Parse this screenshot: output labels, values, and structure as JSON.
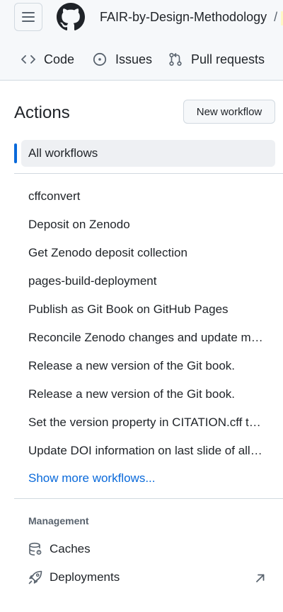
{
  "header": {
    "repo_name": "FAIR-by-Design-Methodology",
    "separator": "/",
    "tabs": [
      {
        "label": "Code",
        "icon": "code-icon"
      },
      {
        "label": "Issues",
        "icon": "issue-icon"
      },
      {
        "label": "Pull requests",
        "icon": "pull-request-icon"
      }
    ]
  },
  "actions": {
    "title": "Actions",
    "new_workflow_label": "New workflow",
    "all_workflows_label": "All workflows",
    "workflows": [
      "cffconvert",
      "Deposit on Zenodo",
      "Get Zenodo deposit collection",
      "pages-build-deployment",
      "Publish as Git Book on GitHub Pages",
      "Reconcile Zenodo changes and update m…",
      "Release a new version of the Git book.",
      "Release a new version of the Git book.",
      "Set the version property in CITATION.cff t…",
      "Update DOI information on last slide of all…"
    ],
    "show_more_label": "Show more workflows..."
  },
  "management": {
    "label": "Management",
    "items": [
      {
        "label": "Caches",
        "icon": "database-icon"
      },
      {
        "label": "Deployments",
        "icon": "rocket-icon",
        "external_icon": "arrow-up-right-icon"
      }
    ]
  },
  "colors": {
    "accent": "#0969da",
    "header_bg": "#f6f8fa",
    "selected_bg": "#eef0f3",
    "border": "#d1d9e0"
  }
}
